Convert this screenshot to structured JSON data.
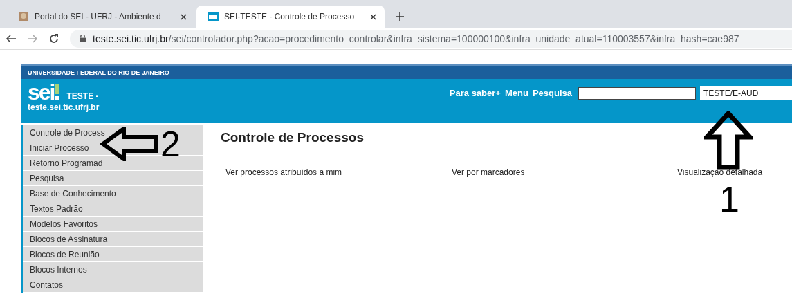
{
  "browser": {
    "tabs": [
      {
        "title": "Portal do SEI - UFRJ - Ambiente d",
        "selected": false,
        "kind": "portal"
      },
      {
        "title": "SEI-TESTE - Controle de Processo",
        "selected": true,
        "kind": "sei"
      }
    ],
    "url_host": "teste.sei.tic.ufrj.br",
    "url_path": "/sei/controlador.php?acao=procedimento_controlar&infra_sistema=100000100&infra_unidade_atual=110003557&infra_hash=cae987"
  },
  "header": {
    "institution": "UNIVERSIDADE FEDERAL DO RIO DE JANEIRO",
    "logo_text": "sei",
    "environment": "TESTE -",
    "host": "teste.sei.tic.ufrj.br",
    "links": [
      "Para saber+",
      "Menu",
      "Pesquisa"
    ],
    "unit": "TESTE/E-AUD"
  },
  "sidebar": {
    "items": [
      "Controle de Process",
      "Iniciar Processo",
      "Retorno Programad",
      "Pesquisa",
      "Base de Conhecimento",
      "Textos Padrão",
      "Modelos Favoritos",
      "Blocos de Assinatura",
      "Blocos de Reunião",
      "Blocos Internos",
      "Contatos"
    ]
  },
  "content": {
    "title": "Controle de Processos",
    "links": [
      "Ver processos atribuídos a mim",
      "Ver por marcadores",
      "Visualização detalhada"
    ]
  },
  "annotations": [
    {
      "kind": "left",
      "number": "2"
    },
    {
      "kind": "up",
      "number": "1"
    }
  ]
}
